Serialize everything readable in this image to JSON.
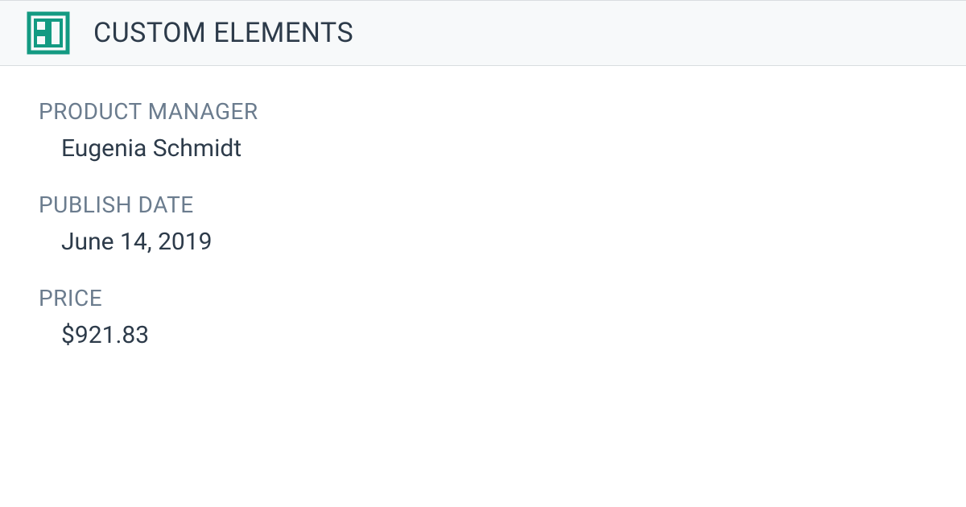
{
  "header": {
    "title": "CUSTOM ELEMENTS"
  },
  "fields": {
    "product_manager": {
      "label": "PRODUCT MANAGER",
      "value": "Eugenia Schmidt"
    },
    "publish_date": {
      "label": "PUBLISH DATE",
      "value": "June 14, 2019"
    },
    "price": {
      "label": "PRICE",
      "value": "$921.83"
    }
  }
}
